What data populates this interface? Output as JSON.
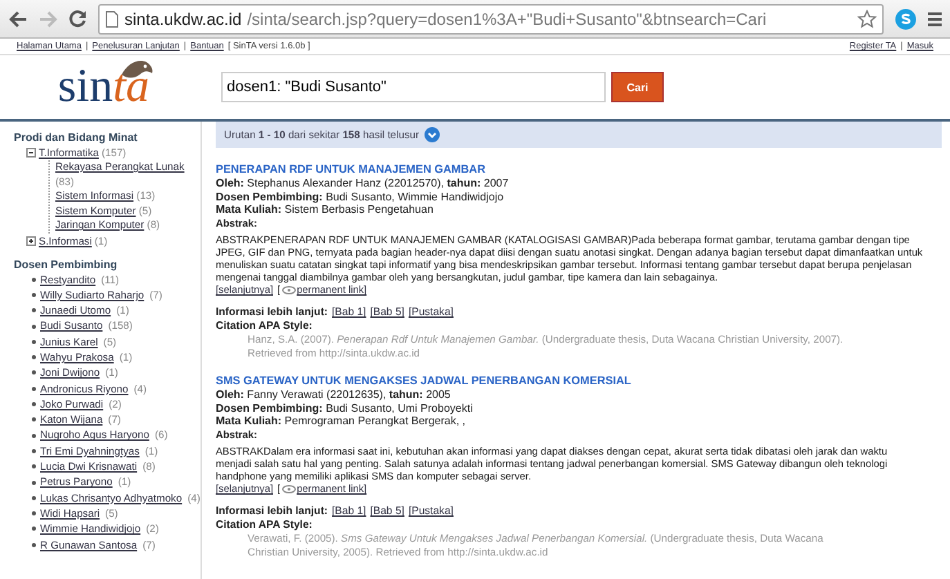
{
  "browser": {
    "url_host": "sinta.ukdw.ac.id",
    "url_path": "/sinta/search.jsp?query=dosen1%3A+\"Budi+Susanto\"&btnsearch=Cari"
  },
  "top_links_left": [
    {
      "text": "Halaman Utama"
    },
    {
      "sep": "|",
      "text": "Penelusuran Lanjutan"
    },
    {
      "sep": "|",
      "text": "Bantuan"
    }
  ],
  "version": "[ SinTA versi 1.6.0b ]",
  "top_links_right": [
    {
      "text": "Register TA"
    },
    {
      "sep": "|",
      "text": "Masuk"
    }
  ],
  "logo": {
    "text": "sin",
    "accent": "ta"
  },
  "search": {
    "value": "dosen1: \"Budi Susanto\"",
    "button": "Cari"
  },
  "sidebar": {
    "prodi_title": "Prodi dan Bidang Minat",
    "prodi": [
      {
        "label": "T.Informatika",
        "count": "(157)",
        "expanded": true,
        "children": [
          {
            "label": "Rekayasa Perangkat Lunak",
            "count": "(83)"
          },
          {
            "label": "Sistem Informasi",
            "count": "(13)"
          },
          {
            "label": "Sistem Komputer",
            "count": "(5)"
          },
          {
            "label": "Jaringan Komputer",
            "count": "(8)"
          }
        ]
      },
      {
        "label": "S.Informasi",
        "count": "(1)",
        "expanded": false
      }
    ],
    "dosen_title": "Dosen Pembimbing",
    "dosen": [
      {
        "name": "Restyandito",
        "count": "(11)"
      },
      {
        "name": "Willy Sudiarto Raharjo",
        "count": "(7)"
      },
      {
        "name": "Junaedi Utomo",
        "count": "(1)"
      },
      {
        "name": "Budi Susanto",
        "count": "(158)"
      },
      {
        "name": "Junius Karel",
        "count": "(5)"
      },
      {
        "name": "Wahyu Prakosa",
        "count": "(1)"
      },
      {
        "name": "Joni Dwijono",
        "count": "(1)"
      },
      {
        "name": "Andronicus Riyono",
        "count": "(4)"
      },
      {
        "name": "Joko Purwadi",
        "count": "(2)"
      },
      {
        "name": "Katon Wijana",
        "count": "(7)"
      },
      {
        "name": "Nugroho Agus Haryono",
        "count": "(6)"
      },
      {
        "name": "Tri Emi Dyahningtyas",
        "count": "(1)"
      },
      {
        "name": "Lucia Dwi Krisnawati",
        "count": "(8)"
      },
      {
        "name": "Petrus Paryono",
        "count": "(1)"
      },
      {
        "name": "Lukas Chrisantyo Adhyatmoko",
        "count": "(4)"
      },
      {
        "name": "Widi Hapsari",
        "count": "(5)"
      },
      {
        "name": "Wimmie Handiwidjojo",
        "count": "(2)"
      },
      {
        "name": "R Gunawan Santosa",
        "count": "(7)"
      }
    ]
  },
  "summary": "Urutan **1 - 10** dari sekitar **158** hasil telusur",
  "results": [
    {
      "title": "PENERAPAN RDF UNTUK MANAJEMEN GAMBAR",
      "meta": [
        "**Oleh:** Stephanus Alexander Hanz (22012570), **tahun:** 2007",
        "**Dosen Pembimbing:** Budi Susanto, Wimmie Handiwidjojo",
        "**Mata Kuliah:** Sistem Berbasis Pengetahuan"
      ],
      "abstract_label": "Abstrak:",
      "abstract": "ABSTRAKPENERAPAN RDF UNTUK MANAJEMEN GAMBAR (KATALOGISASI GAMBAR)Pada beberapa format gambar, terutama gambar dengan tipe JPEG, GIF dan PNG, ternyata pada bagian header-nya dapat diisi dengan suatu anotasi singkat. Dengan adanya bagian tersebut dapat dimanfaatkan untuk menuliskan suatu catatan singkat tapi informatif yang bisa mendeskripsikan gambar tersebut. Informasi tentang gambar tersebut dapat berupa penjelasan mengenai tanggal diambilnya gambar oleh yang bersangkutan, judul gambar, tipe kamera dan lain sebagainya.",
      "more": "[selanjutnya]",
      "permalink_open": "[",
      "permalink": "permanent link]",
      "info_label": "Informasi lebih lanjut:",
      "info_links": [
        "[Bab 1]",
        "[Bab 5]",
        "[Pustaka]"
      ],
      "citation_label": "Citation APA Style:",
      "citation": "Hanz, S.A. (2007). *Penerapan Rdf Untuk Manajemen Gambar.* (Undergraduate thesis, Duta Wacana Christian University, 2007). Retrieved from http://sinta.ukdw.ac.id"
    },
    {
      "title": "SMS GATEWAY UNTUK MENGAKSES JADWAL PENERBANGAN KOMERSIAL",
      "meta": [
        "**Oleh:** Fanny Verawati (22012635), **tahun:** 2005",
        "**Dosen Pembimbing:** Budi Susanto, Umi Proboyekti",
        "**Mata Kuliah:** Pemrograman Perangkat Bergerak, ,"
      ],
      "abstract_label": "Abstrak:",
      "abstract": "ABSTRAKDalam era informasi saat ini, kebutuhan akan informasi yang dapat diakses dengan cepat, akurat serta tidak dibatasi oleh jarak dan waktu menjadi salah satu hal yang penting. Salah satunya adalah informasi tentang jadwal penerbangan komersial. SMS Gateway dibangun oleh teknologi handphone yang memiliki aplikasi SMS dan komputer sebagai server.",
      "more": "[selanjutnya]",
      "permalink_open": "[",
      "permalink": "permanent link]",
      "info_label": "Informasi lebih lanjut:",
      "info_links": [
        "[Bab 1]",
        "[Bab 5]",
        "[Pustaka]"
      ],
      "citation_label": "Citation APA Style:",
      "citation": "Verawati, F. (2005). *Sms Gateway Untuk Mengakses Jadwal Penerbangan Komersial.* (Undergraduate thesis, Duta Wacana Christian University, 2005). Retrieved from http://sinta.ukdw.ac.id"
    }
  ]
}
